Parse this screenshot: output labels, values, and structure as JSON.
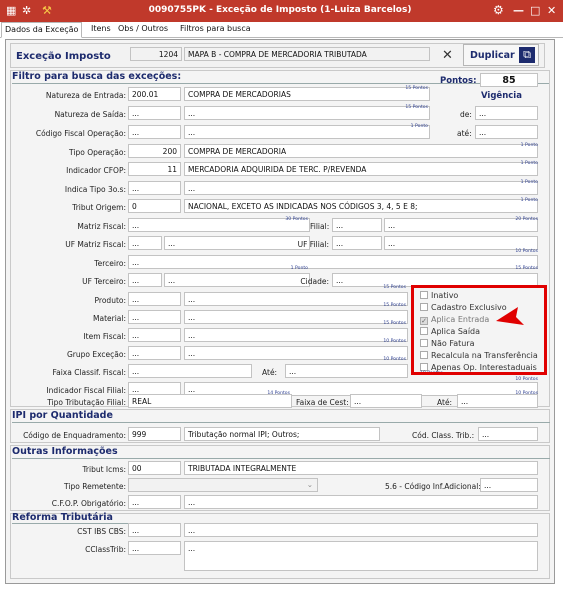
{
  "window": {
    "title": "0090755PK - Exceção de Imposto (1-Luiza Barcelos)"
  },
  "tabs": [
    "Dados da Exceção",
    "Itens",
    "Obs / Outros",
    "Filtros para busca"
  ],
  "header": {
    "label": "Exceção Imposto",
    "code": "1204",
    "desc": "MAPA B - COMPRA DE MERCADORIA TRIBUTADA",
    "duplicar": "Duplicar"
  },
  "filtro": {
    "title": "Filtro para busca das exceções:",
    "pontos_label": "Pontos:",
    "pontos_value": "85",
    "vigencia": "Vigência",
    "de": "de:",
    "ate": "até:",
    "natureza_entrada": {
      "label": "Natureza de Entrada:",
      "code": "200.01",
      "desc": "COMPRA DE MERCADORIAS",
      "pts": "15 Pontos"
    },
    "natureza_saida": {
      "label": "Natureza de Saída:",
      "code": "...",
      "desc": "...",
      "pts": "15 Pontos"
    },
    "cfop": {
      "label": "Código Fiscal Operação:",
      "code": "...",
      "desc": "...",
      "pts": "1 Ponto"
    },
    "tipo_operacao": {
      "label": "Tipo Operação:",
      "code": "200",
      "desc": "COMPRA DE MERCADORIA",
      "pts": "1 Ponto"
    },
    "indicador_cfop": {
      "label": "Indicador CFOP:",
      "code": "11",
      "desc": "MERCADORIA ADQUIRIDA DE TERC. P/REVENDA",
      "pts": "1 Ponto"
    },
    "indica_tipo": {
      "label": "Indica Tipo 3o.s:",
      "code": "...",
      "desc": "...",
      "pts": "1 Ponto"
    },
    "tribut_origem": {
      "label": "Tribut Origem:",
      "code": "0",
      "desc": "NACIONAL, EXCETO AS INDICADAS NOS CÓDIGOS 3, 4, 5 E 8;",
      "pts": "1 Ponto"
    },
    "matriz_fiscal": {
      "label": "Matriz Fiscal:",
      "code": "...",
      "pts": "30 Pontos",
      "filial_label": "Filial:",
      "filial_code": "...",
      "filial_desc": "...",
      "filial_pts": "20 Pontos"
    },
    "uf_matriz": {
      "label": "UF Matriz Fiscal:",
      "code": "...",
      "desc": "...",
      "uf_filial_label": "UF Filial:",
      "uf_filial_code": "...",
      "uf_filial_desc": "..."
    },
    "terceiro": {
      "label": "Terceiro:",
      "code": "...",
      "pts": "10 Pontos"
    },
    "uf_terceiro": {
      "label": "UF Terceiro:",
      "code": "...",
      "desc": "...",
      "pts": "1 Ponto",
      "cidade_label": "Cidade:",
      "cidade_code": "...",
      "cidade_pts": "15 Pontos"
    },
    "produto": {
      "label": "Produto:",
      "code": "...",
      "desc": "...",
      "pts": "15 Pontos"
    },
    "material": {
      "label": "Material:",
      "code": "...",
      "desc": "...",
      "pts": "15 Pontos"
    },
    "item_fiscal": {
      "label": "Item Fiscal:",
      "code": "...",
      "desc": "...",
      "pts": "15 Pontos"
    },
    "grupo_excecao": {
      "label": "Grupo Exceção:",
      "code": "...",
      "desc": "...",
      "pts": "10 Pontos"
    },
    "faixa_classif": {
      "label": "Faixa Classif. Fiscal:",
      "code": "...",
      "ate_label": "Até:",
      "ate_value": "...",
      "pts": "10 Pontos"
    },
    "indicador_fiscal_filial": {
      "label": "Indicador Fiscal Filial:",
      "code": "...",
      "desc": "...",
      "pts": "10 Pontos"
    },
    "tipo_tributacao_filial": {
      "label": "Tipo Tributação Filial:",
      "code": "REAL",
      "pts": "14 Pontos",
      "faixa_cest_label": "Faixa de Cest:",
      "faixa_cest_value": "...",
      "ate_label": "Até:",
      "ate_value": "...",
      "ate_pts": "10 Pontos"
    },
    "checkboxes": [
      {
        "label": "Inativo",
        "checked": false,
        "disabled": false
      },
      {
        "label": "Cadastro Exclusivo",
        "checked": false,
        "disabled": false
      },
      {
        "label": "Aplica Entrada",
        "checked": true,
        "disabled": true
      },
      {
        "label": "Aplica Saída",
        "checked": false,
        "disabled": false
      },
      {
        "label": "Não Fatura",
        "checked": false,
        "disabled": false
      },
      {
        "label": "Recalcula na Transferência",
        "checked": false,
        "disabled": false
      },
      {
        "label": "Apenas Op. Interestaduais",
        "checked": false,
        "disabled": false
      }
    ],
    "cb_pts": "10 Pontos"
  },
  "ipi": {
    "title": "IPI por Quantidade",
    "cod_label": "Código de Enquadramento:",
    "cod": "999",
    "desc": "Tributação normal IPI; Outros;",
    "class_label": "Cód. Class. Trib.:",
    "class_value": "..."
  },
  "outras": {
    "title": "Outras Informações",
    "tribut_label": "Tribut Icms:",
    "tribut_code": "00",
    "tribut_desc": "TRIBUTADA INTEGRALMENTE",
    "remetente_label": "Tipo Remetente:",
    "inf_label": "5.6 - Código Inf.Adicional:",
    "inf_value": "...",
    "cfop_label": "C.F.O.P. Obrigatório:",
    "cfop_code": "...",
    "cfop_desc": "..."
  },
  "reforma": {
    "title": "Reforma Tributária",
    "cst_label": "CST IBS CBS:",
    "cst_code": "...",
    "cst_desc": "...",
    "cclass_label": "CClassTrib:",
    "cclass_code": "...",
    "cclass_desc": "..."
  },
  "colors": {
    "titlebar": "#c0392b",
    "section": "#1d2b6e",
    "highlight": "#e00000"
  }
}
